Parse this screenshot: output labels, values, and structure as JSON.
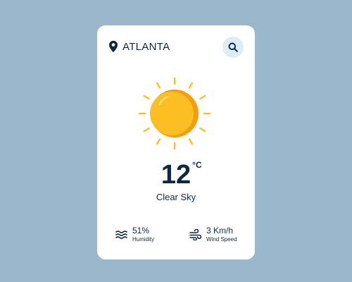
{
  "weather": {
    "city": "ATLANTA",
    "temperature": "12",
    "unit": "°C",
    "condition": "Clear Sky",
    "humidity": {
      "value": "51%",
      "label": "Humidity"
    },
    "wind": {
      "value": "3 Km/h",
      "label": "Wind Speed"
    }
  },
  "icons": {
    "location": "location-pin-icon",
    "search": "search-icon",
    "weather": "sun-icon",
    "humidity": "waves-icon",
    "wind": "wind-icon"
  },
  "colors": {
    "background": "#9bb7cc",
    "card": "#ffffff",
    "text": "#0f2742",
    "sun": "#fbbf24",
    "sun_shade": "#f59e0b",
    "rays": "#fbbf24",
    "search_bg": "#dcedf8"
  }
}
